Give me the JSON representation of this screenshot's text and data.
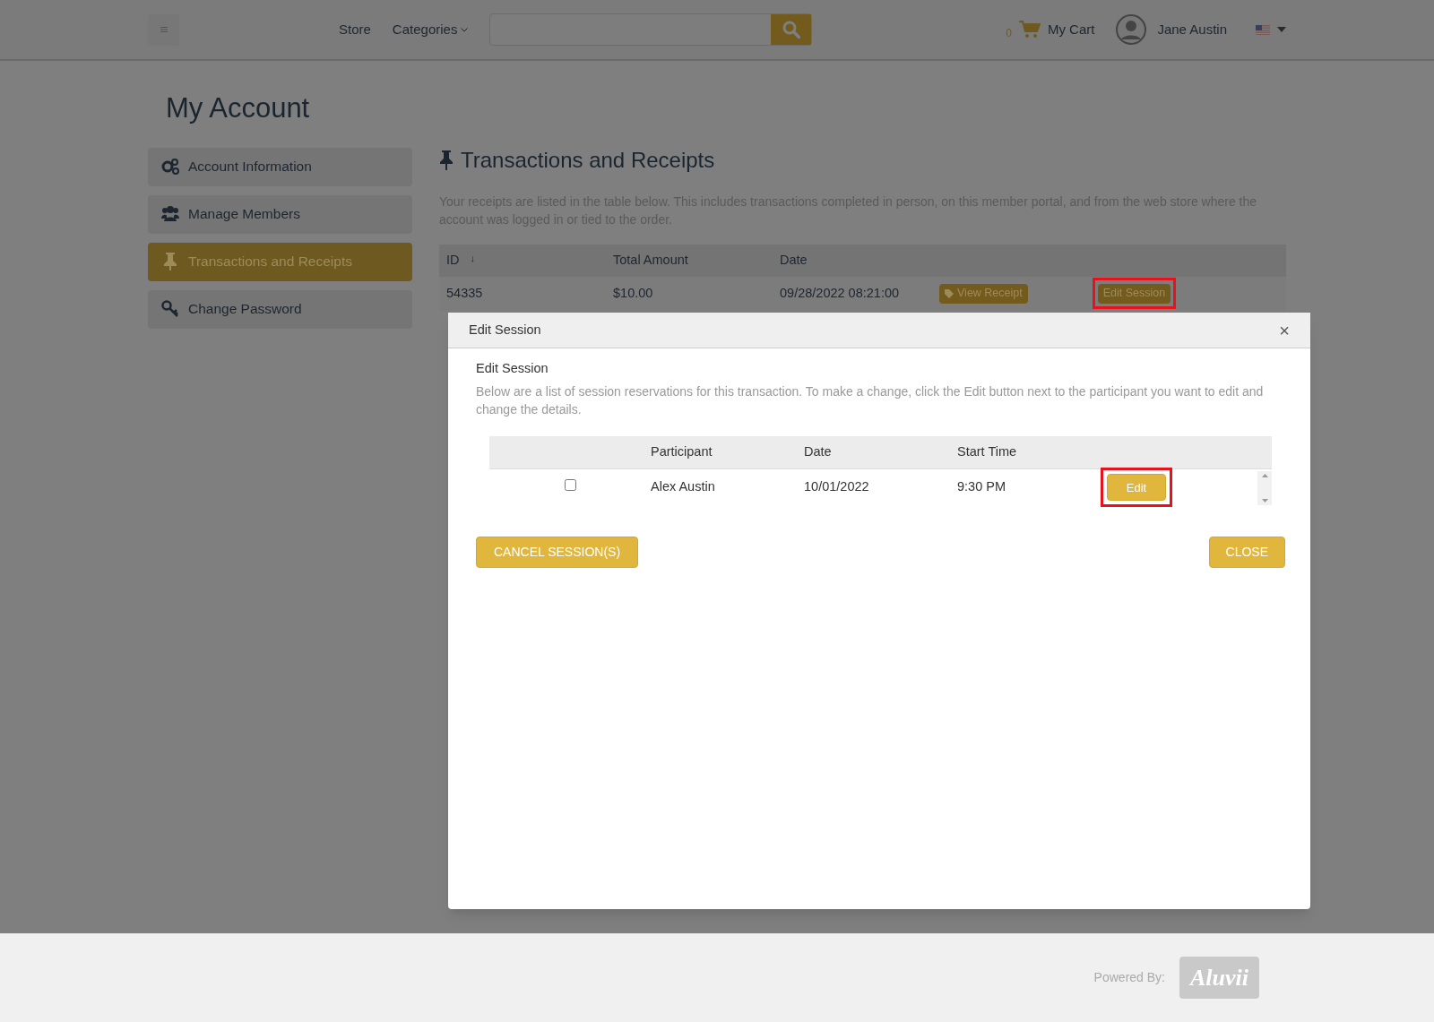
{
  "header": {
    "nav": [
      {
        "label": "Store",
        "kind": "link"
      },
      {
        "label": "Categories",
        "kind": "dropdown"
      }
    ],
    "cart_count": "0",
    "cart_label": "My Cart",
    "user_name": "Jane Austin"
  },
  "page_title": "My Account",
  "sidebar": {
    "items": [
      {
        "label": "Account Information",
        "kind": "gears",
        "selected": false
      },
      {
        "label": "Manage Members",
        "kind": "users",
        "selected": false
      },
      {
        "label": "Transactions and Receipts",
        "kind": "pin",
        "selected": true
      },
      {
        "label": "Change Password",
        "kind": "key",
        "selected": false
      }
    ]
  },
  "section": {
    "title": "Transactions and Receipts",
    "description": "Your receipts are listed in the table below. This includes transactions completed in person, on this member portal, and from the web store where the account was logged in or tied to the order.",
    "table": {
      "columns": [
        {
          "label": "ID",
          "sort": "↓"
        },
        {
          "label": "Total Amount"
        },
        {
          "label": "Date"
        }
      ],
      "rows": [
        {
          "id": "54335",
          "total": "$10.00",
          "date": "09/28/2022 08:21:00",
          "receipt_button": "View Receipt",
          "session_button": {
            "label": "Edit Session",
            "highlighted": true
          }
        }
      ]
    }
  },
  "modal": {
    "title": "Edit Session",
    "close": "×",
    "heading": "Edit Session",
    "text": "Below are a list of session reservations for this transaction. To make a change, click the Edit button next to the participant you want to edit and change the details.",
    "columns": [
      "Participant",
      "Date",
      "Start Time"
    ],
    "rows": [
      {
        "checked": false,
        "participant": "Alex Austin",
        "date": "10/01/2022",
        "start_time": "9:30 PM",
        "edit_button": {
          "label": "Edit",
          "highlighted": true
        }
      }
    ],
    "cancel_button": "CANCEL SESSION(S)",
    "close_button": "CLOSE"
  },
  "footer": {
    "powered_by": "Powered By:",
    "logo": "Aluvii"
  }
}
